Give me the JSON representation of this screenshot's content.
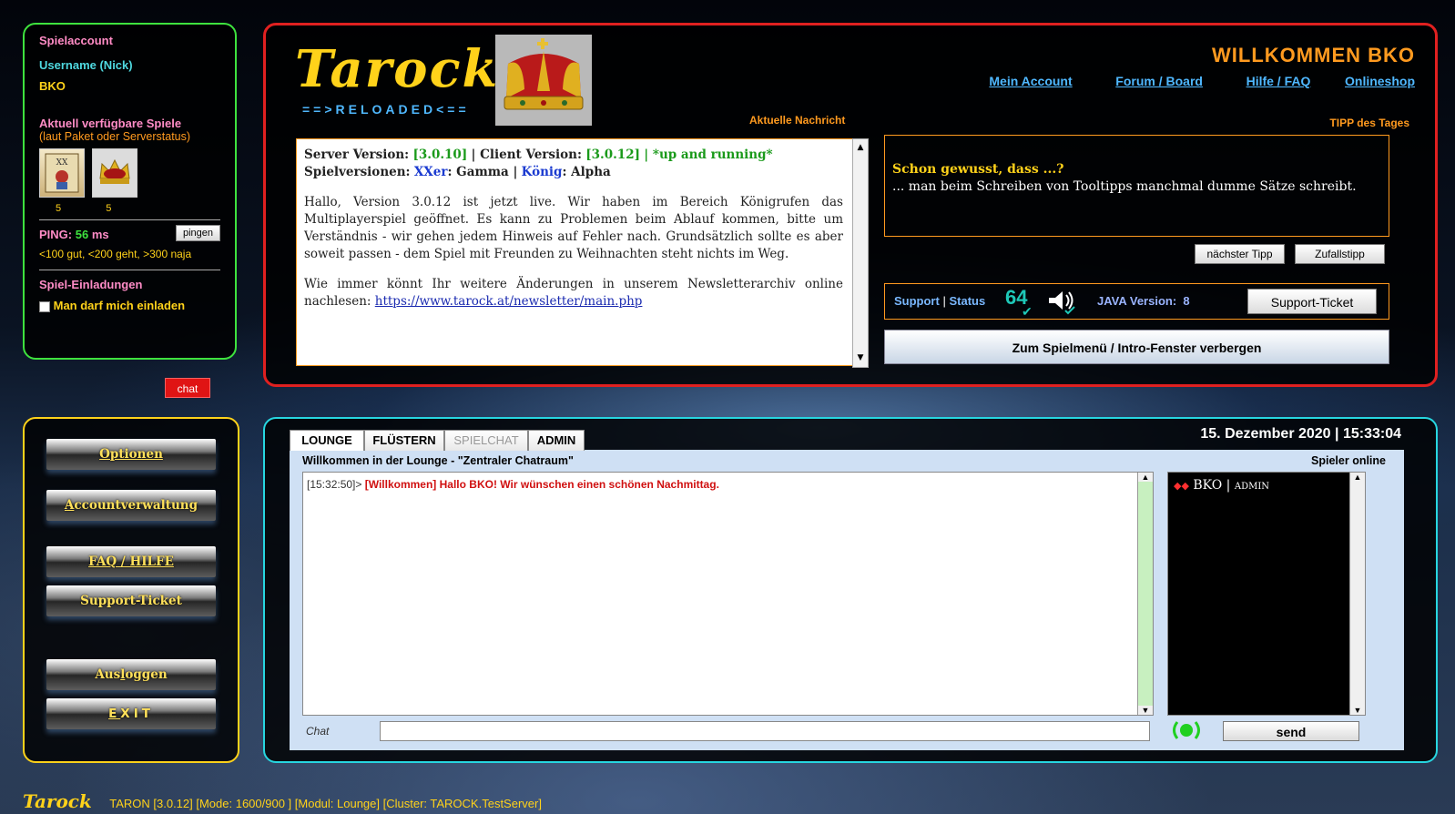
{
  "account": {
    "title": "Spielaccount",
    "username_label": "Username (Nick)",
    "username": "BKO",
    "games_title": "Aktuell verfügbare Spiele",
    "games_subtitle": "(laut Paket oder Serverstatus)",
    "games": [
      {
        "icon": "tarot-card-icon",
        "count": "5"
      },
      {
        "icon": "crown-icon",
        "count": "5"
      }
    ],
    "ping_label": "PING:",
    "ping_value": "56",
    "ping_unit": "ms",
    "ping_button": "pingen",
    "ping_hint": "<100 gut, <200 geht, >300 naja",
    "invite_title": "Spiel-Einladungen",
    "invite_checkbox": "Man darf mich einladen"
  },
  "chat_tag": "chat",
  "header": {
    "logo_text": "Tarock",
    "logo_sub": "==>RELOADED<==",
    "welcome": "WILLKOMMEN  BKO",
    "links": [
      "Mein Account",
      "Forum / Board",
      "Hilfe / FAQ",
      "Onlineshop"
    ],
    "news_caption": "Aktuelle Nachricht",
    "tip_caption": "TIPP des Tages"
  },
  "news": {
    "server_label": "Server Version:",
    "server_version": "[3.0.10]",
    "client_label": "| Client Version:",
    "client_version": "[3.0.12]",
    "status": "| *up and running*",
    "versions_label": "Spielversionen:",
    "game1": "XXer",
    "game1_state": ": Gamma |",
    "game2": "König",
    "game2_state": ": Alpha",
    "paragraph1": "Hallo, Version 3.0.12 ist jetzt live. Wir haben im Bereich Königrufen das Multiplayerspiel geöffnet. Es kann zu Problemen beim Ablauf kommen, bitte um Verständnis - wir gehen jedem Hinweis auf Fehler nach. Grundsätzlich sollte es aber soweit passen - dem Spiel mit Freunden zu Weihnachten steht nichts im Weg.",
    "paragraph2": "Wie immer könnt Ihr weitere Änderungen in unserem Newsletterarchiv online nachlesen:",
    "link": "https://www.tarock.at/newsletter/main.php"
  },
  "tip": {
    "heading": "Schon gewusst, dass ...?",
    "text": "... man beim Schreiben von Tooltipps manchmal dumme Sätze schreibt.",
    "next_button": "nächster Tipp",
    "random_button": "Zufallstipp"
  },
  "support": {
    "support_label": "Support",
    "status_label": "Status",
    "badge": "64",
    "java_label": "JAVA Version:",
    "java_version": "8",
    "ticket_button": "Support-Ticket",
    "intro_button": "Zum Spielmenü / Intro-Fenster verbergen"
  },
  "nav": {
    "optionen": "Optionen",
    "account_pre": "",
    "account_u": "A",
    "account_rest": "ccountverwaltung",
    "faq": "FAQ / HILFE",
    "ticket": "Support-Ticket",
    "logout_pre": "Aus",
    "logout_u": "l",
    "logout_rest": "oggen",
    "exit_u": "E",
    "exit_rest": "XIT"
  },
  "chat": {
    "datetime": "15. Dezember 2020 | 15:33:04",
    "tabs": [
      "LOUNGE",
      "FLÜSTERN",
      "SPIELCHAT",
      "ADMIN"
    ],
    "room_title": "Willkommen in der Lounge - \"Zentraler Chatraum\"",
    "players_title": "Spieler online",
    "messages": [
      {
        "time": "[15:32:50]>",
        "text": "[Willkommen] Hallo BKO! Wir wünschen einen schönen Nachmittag."
      }
    ],
    "players": [
      {
        "name": "BKO",
        "role": "ADMIN"
      }
    ],
    "input_label": "Chat",
    "input_value": "",
    "send_button": "send"
  },
  "footer": {
    "logo": "Tarock",
    "status": "TARON [3.0.12] [Mode: 1600/900 ] [Modul: Lounge] [Cluster: TAROCK.TestServer]"
  },
  "colors": {
    "account_border": "#3ee23e",
    "top_border": "#e02020",
    "nav_border": "#ffd21a",
    "chat_border": "#27d6e0",
    "accent_orange": "#ff9a1f"
  }
}
